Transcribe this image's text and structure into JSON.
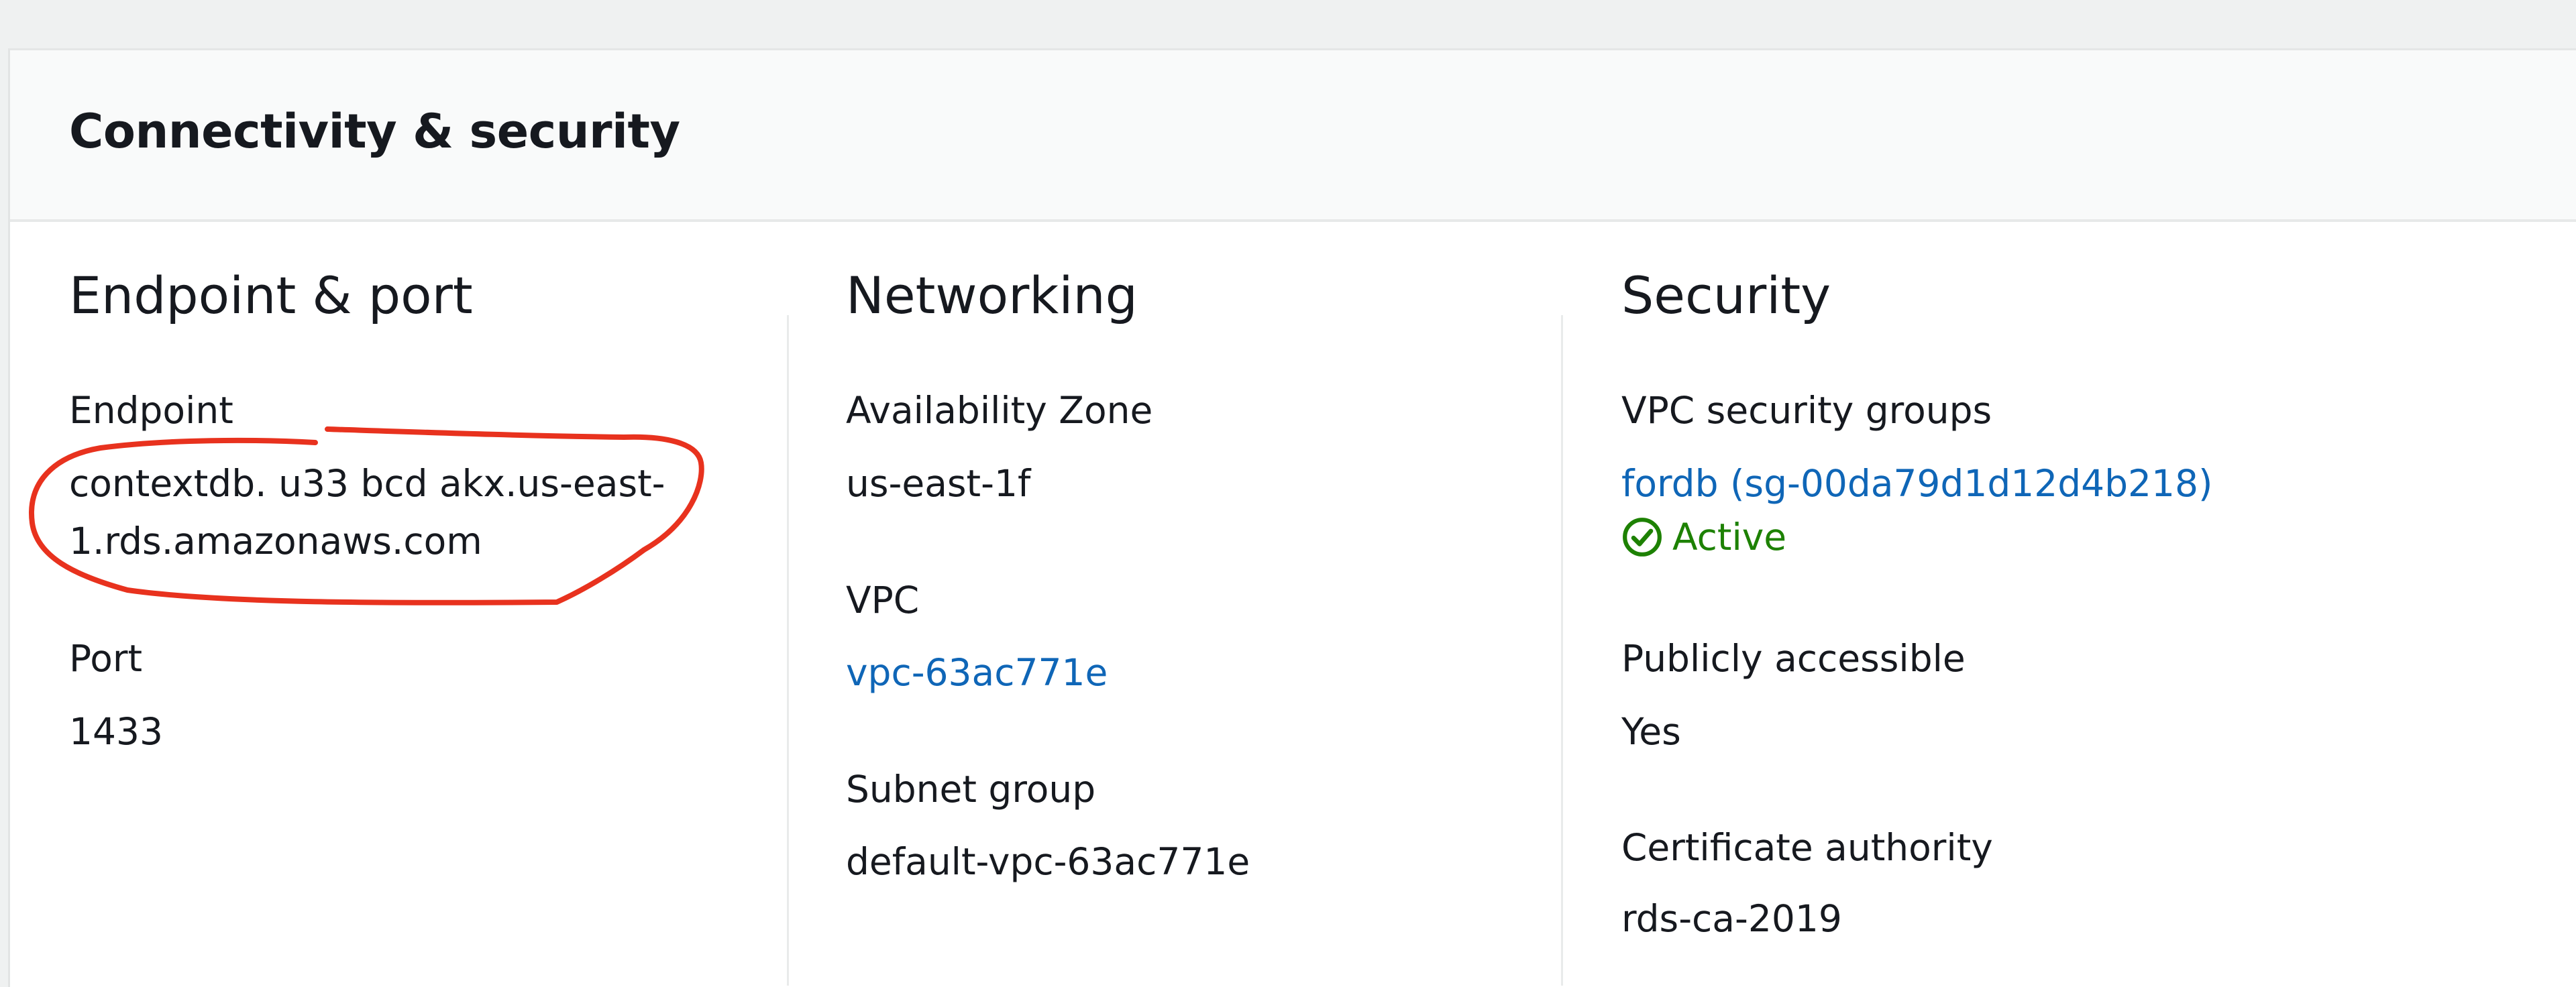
{
  "section": {
    "title": "Connectivity & security"
  },
  "columns": {
    "endpoint_port": {
      "heading": "Endpoint & port",
      "endpoint_label": "Endpoint",
      "endpoint_line1": "contextdb. u33 bcd  akx.us-east-",
      "endpoint_line2": "1.rds.amazonaws.com",
      "port_label": "Port",
      "port_value": "1433"
    },
    "networking": {
      "heading": "Networking",
      "az_label": "Availability Zone",
      "az_value": "us-east-1f",
      "vpc_label": "VPC",
      "vpc_value": "vpc-63ac771e",
      "subnet_label": "Subnet group",
      "subnet_value": "default-vpc-63ac771e"
    },
    "security": {
      "heading": "Security",
      "sg_label": "VPC security groups",
      "sg_value": "fordb (sg-00da79d1d12d4b218)",
      "sg_status": "Active",
      "public_label": "Publicly accessible",
      "public_value": "Yes",
      "ca_label": "Certificate authority",
      "ca_value": "rds-ca-2019"
    }
  },
  "colors": {
    "link": "#0f66b7",
    "status_active": "#1d8102",
    "annotation": "#e8321e"
  },
  "icons": {
    "status": "check-circle-icon"
  }
}
